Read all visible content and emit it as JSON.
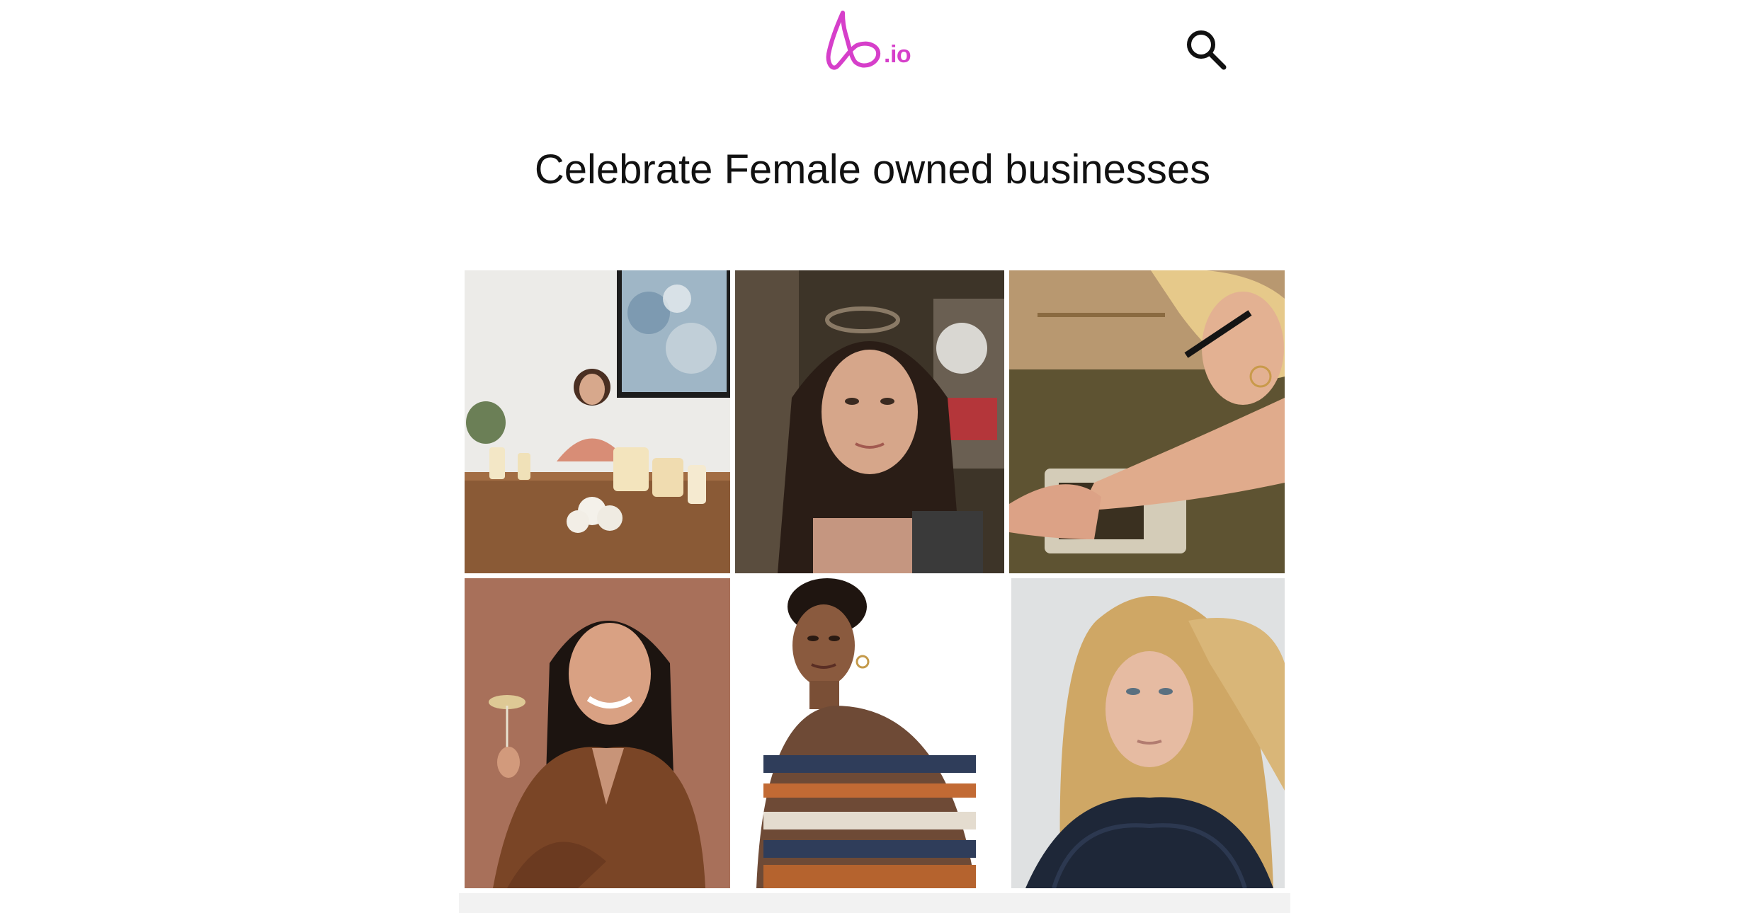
{
  "header": {
    "logo_suffix": ".io",
    "logo_icon": "heart-outline-icon",
    "search_icon": "search-icon",
    "brand_color": "#d63fca"
  },
  "headline": "Celebrate Female owned businesses",
  "photos": [
    {
      "subject": "woman seated at table with cleaning products"
    },
    {
      "subject": "woman with long dark hair and sunglasses on head"
    },
    {
      "subject": "older blonde woman with glasses working at table"
    },
    {
      "subject": "woman in brown leather jacket holding a coupe glass"
    },
    {
      "subject": "model with short curly hair in patterned sweater"
    },
    {
      "subject": "blonde woman in dark knit sweater"
    }
  ]
}
